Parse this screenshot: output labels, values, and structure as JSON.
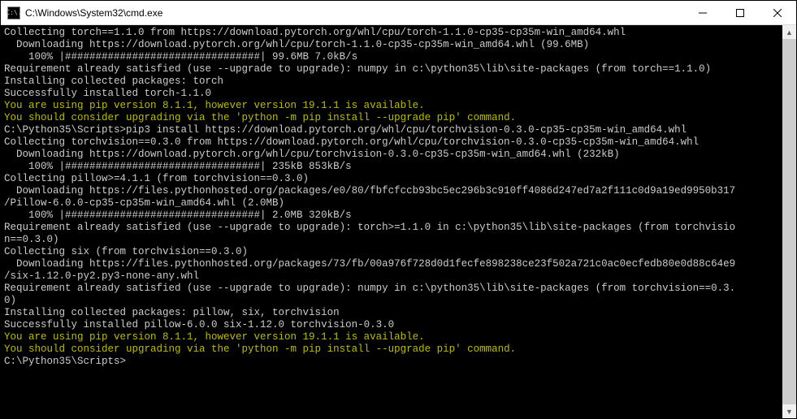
{
  "titlebar": {
    "icon_text": "C:\\.",
    "title": "C:\\Windows\\System32\\cmd.exe"
  },
  "lines": [
    {
      "text": "Collecting torch==1.1.0 from https://download.pytorch.org/whl/cpu/torch-1.1.0-cp35-cp35m-win_amd64.whl",
      "cls": "c-white"
    },
    {
      "text": "  Downloading https://download.pytorch.org/whl/cpu/torch-1.1.0-cp35-cp35m-win_amd64.whl (99.6MB)",
      "cls": "c-white"
    },
    {
      "text": "    100% |################################| 99.6MB 7.0kB/s",
      "cls": "c-white"
    },
    {
      "text": "Requirement already satisfied (use --upgrade to upgrade): numpy in c:\\python35\\lib\\site-packages (from torch==1.1.0)",
      "cls": "c-white"
    },
    {
      "text": "Installing collected packages: torch",
      "cls": "c-white"
    },
    {
      "text": "Successfully installed torch-1.1.0",
      "cls": "c-white"
    },
    {
      "text": "You are using pip version 8.1.1, however version 19.1.1 is available.",
      "cls": "c-yellow"
    },
    {
      "text": "You should consider upgrading via the 'python -m pip install --upgrade pip' command.",
      "cls": "c-yellow"
    },
    {
      "text": "",
      "cls": "c-white"
    },
    {
      "text": "C:\\Python35\\Scripts>pip3 install https://download.pytorch.org/whl/cpu/torchvision-0.3.0-cp35-cp35m-win_amd64.whl",
      "cls": "c-white"
    },
    {
      "text": "Collecting torchvision==0.3.0 from https://download.pytorch.org/whl/cpu/torchvision-0.3.0-cp35-cp35m-win_amd64.whl",
      "cls": "c-white"
    },
    {
      "text": "  Downloading https://download.pytorch.org/whl/cpu/torchvision-0.3.0-cp35-cp35m-win_amd64.whl (232kB)",
      "cls": "c-white"
    },
    {
      "text": "    100% |################################| 235kB 853kB/s",
      "cls": "c-white"
    },
    {
      "text": "Collecting pillow>=4.1.1 (from torchvision==0.3.0)",
      "cls": "c-white"
    },
    {
      "text": "  Downloading https://files.pythonhosted.org/packages/e0/80/fbfcfccb93bc5ec296b3c910ff4086d247ed7a2f111c0d9a19ed9950b317",
      "cls": "c-white"
    },
    {
      "text": "/Pillow-6.0.0-cp35-cp35m-win_amd64.whl (2.0MB)",
      "cls": "c-white"
    },
    {
      "text": "    100% |################################| 2.0MB 320kB/s",
      "cls": "c-white"
    },
    {
      "text": "Requirement already satisfied (use --upgrade to upgrade): torch>=1.1.0 in c:\\python35\\lib\\site-packages (from torchvisio",
      "cls": "c-white"
    },
    {
      "text": "n==0.3.0)",
      "cls": "c-white"
    },
    {
      "text": "Collecting six (from torchvision==0.3.0)",
      "cls": "c-white"
    },
    {
      "text": "  Downloading https://files.pythonhosted.org/packages/73/fb/00a976f728d0d1fecfe898238ce23f502a721c0ac0ecfedb80e0d88c64e9",
      "cls": "c-white"
    },
    {
      "text": "/six-1.12.0-py2.py3-none-any.whl",
      "cls": "c-white"
    },
    {
      "text": "Requirement already satisfied (use --upgrade to upgrade): numpy in c:\\python35\\lib\\site-packages (from torchvision==0.3.",
      "cls": "c-white"
    },
    {
      "text": "0)",
      "cls": "c-white"
    },
    {
      "text": "Installing collected packages: pillow, six, torchvision",
      "cls": "c-white"
    },
    {
      "text": "Successfully installed pillow-6.0.0 six-1.12.0 torchvision-0.3.0",
      "cls": "c-white"
    },
    {
      "text": "You are using pip version 8.1.1, however version 19.1.1 is available.",
      "cls": "c-yellow"
    },
    {
      "text": "You should consider upgrading via the 'python -m pip install --upgrade pip' command.",
      "cls": "c-yellow"
    },
    {
      "text": "",
      "cls": "c-white"
    },
    {
      "text": "C:\\Python35\\Scripts>",
      "cls": "c-white"
    }
  ]
}
